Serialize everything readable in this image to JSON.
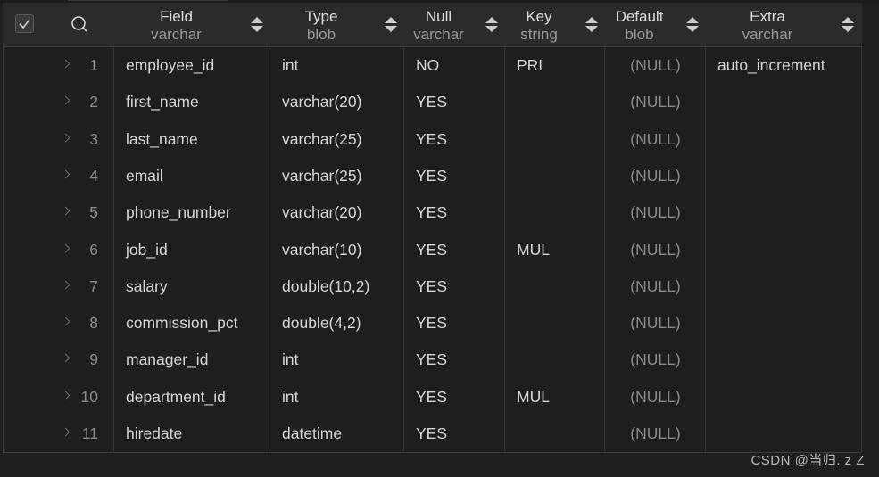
{
  "header": {
    "select_all_checked": true,
    "columns": [
      {
        "name": "Field",
        "type": "varchar"
      },
      {
        "name": "Type",
        "type": "blob"
      },
      {
        "name": "Null",
        "type": "varchar"
      },
      {
        "name": "Key",
        "type": "string"
      },
      {
        "name": "Default",
        "type": "blob"
      },
      {
        "name": "Extra",
        "type": "varchar"
      }
    ]
  },
  "rows": [
    {
      "num": "1",
      "field": "employee_id",
      "type": "int",
      "null": "NO",
      "key": "PRI",
      "default": "(NULL)",
      "extra": "auto_increment"
    },
    {
      "num": "2",
      "field": "first_name",
      "type": "varchar(20)",
      "null": "YES",
      "key": "",
      "default": "(NULL)",
      "extra": ""
    },
    {
      "num": "3",
      "field": "last_name",
      "type": "varchar(25)",
      "null": "YES",
      "key": "",
      "default": "(NULL)",
      "extra": ""
    },
    {
      "num": "4",
      "field": "email",
      "type": "varchar(25)",
      "null": "YES",
      "key": "",
      "default": "(NULL)",
      "extra": ""
    },
    {
      "num": "5",
      "field": "phone_number",
      "type": "varchar(20)",
      "null": "YES",
      "key": "",
      "default": "(NULL)",
      "extra": ""
    },
    {
      "num": "6",
      "field": "job_id",
      "type": "varchar(10)",
      "null": "YES",
      "key": "MUL",
      "default": "(NULL)",
      "extra": ""
    },
    {
      "num": "7",
      "field": "salary",
      "type": "double(10,2)",
      "null": "YES",
      "key": "",
      "default": "(NULL)",
      "extra": ""
    },
    {
      "num": "8",
      "field": "commission_pct",
      "type": "double(4,2)",
      "null": "YES",
      "key": "",
      "default": "(NULL)",
      "extra": ""
    },
    {
      "num": "9",
      "field": "manager_id",
      "type": "int",
      "null": "YES",
      "key": "",
      "default": "(NULL)",
      "extra": ""
    },
    {
      "num": "10",
      "field": "department_id",
      "type": "int",
      "null": "YES",
      "key": "MUL",
      "default": "(NULL)",
      "extra": ""
    },
    {
      "num": "11",
      "field": "hiredate",
      "type": "datetime",
      "null": "YES",
      "key": "",
      "default": "(NULL)",
      "extra": ""
    }
  ],
  "watermark": "CSDN @当归. z Z"
}
